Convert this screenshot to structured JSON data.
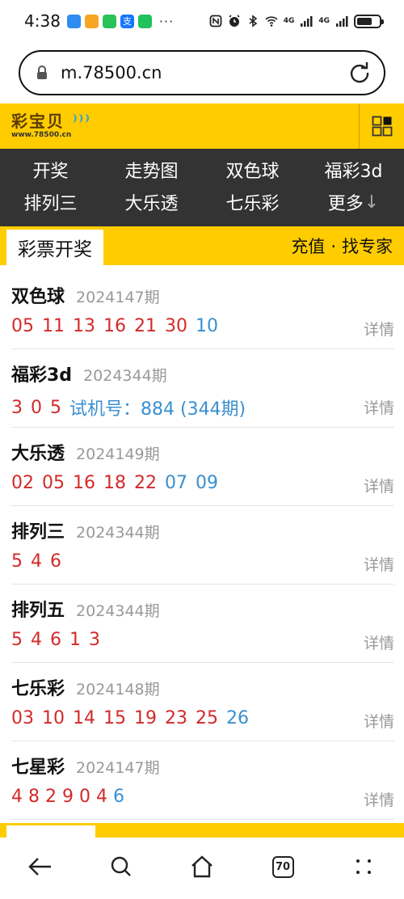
{
  "status_bar": {
    "time": "4:38",
    "more": "···",
    "net1": "4G",
    "net2": "4G",
    "alipay_glyph": "支"
  },
  "browser": {
    "url": "m.78500.cn",
    "tab_count": "70"
  },
  "site": {
    "logo_text": "彩宝贝",
    "logo_domain": "www.78500.cn",
    "colors": {
      "accent": "#ffcc00",
      "nav_bg": "#333333",
      "red": "#d32a2a",
      "blue": "#3a8fd0"
    }
  },
  "nav": {
    "items": [
      "开奖",
      "走势图",
      "双色球",
      "福彩3d",
      "排列三",
      "大乐透",
      "七乐彩",
      "更多"
    ],
    "more_arrow": "↓"
  },
  "section": {
    "tab_label": "彩票开奖",
    "link_recharge": "充值",
    "separator": "·",
    "link_expert": "找专家"
  },
  "results": [
    {
      "name": "双色球",
      "period": "2024147期",
      "red": [
        "05",
        "11",
        "13",
        "16",
        "21",
        "30"
      ],
      "blue": [
        "10"
      ],
      "detail": "详情"
    },
    {
      "name": "福彩3d",
      "period": "2024344期",
      "red": [
        "3",
        "0",
        "5"
      ],
      "trial": "试机号：884 (344期)",
      "detail": "详情"
    },
    {
      "name": "大乐透",
      "period": "2024149期",
      "red": [
        "02",
        "05",
        "16",
        "18",
        "22"
      ],
      "blue": [
        "07",
        "09"
      ],
      "detail": "详情"
    },
    {
      "name": "排列三",
      "period": "2024344期",
      "red": [
        "5",
        "4",
        "6"
      ],
      "detail": "详情"
    },
    {
      "name": "排列五",
      "period": "2024344期",
      "red": [
        "5",
        "4",
        "6",
        "1",
        "3"
      ],
      "detail": "详情"
    },
    {
      "name": "七乐彩",
      "period": "2024148期",
      "red": [
        "03",
        "10",
        "14",
        "15",
        "19",
        "23",
        "25"
      ],
      "blue": [
        "26"
      ],
      "detail": "详情"
    },
    {
      "name": "七星彩",
      "period": "2024147期",
      "red": [
        "4",
        "8",
        "2",
        "9",
        "0",
        "4"
      ],
      "blue": [
        "6"
      ],
      "detail": "详情"
    }
  ],
  "icons": {
    "status": [
      "nfc-icon",
      "alarm-icon",
      "bluetooth-icon",
      "wifi-icon",
      "signal-icon",
      "signal-icon",
      "battery-icon"
    ],
    "bottom_nav": [
      "back-arrow-icon",
      "search-icon",
      "home-icon",
      "tabs-icon",
      "menu-dots-icon"
    ]
  }
}
